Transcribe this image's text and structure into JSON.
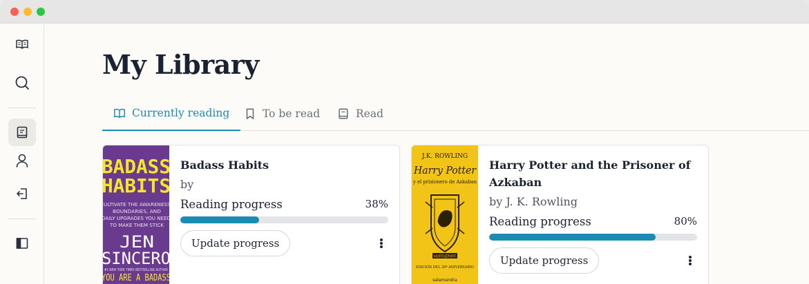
{
  "window": {
    "controls": [
      "close",
      "minimize",
      "maximize"
    ]
  },
  "sidebar": {
    "items": [
      {
        "icon": "open-book-icon",
        "active": false
      },
      {
        "icon": "search-icon",
        "active": false
      },
      {
        "icon": "library-book-icon",
        "active": true
      },
      {
        "icon": "user-icon",
        "active": false
      },
      {
        "icon": "logout-icon",
        "active": false
      },
      {
        "icon": "sidebar-toggle-icon",
        "active": false
      }
    ]
  },
  "page": {
    "title": "My Library"
  },
  "tabs": [
    {
      "label": "Currently reading",
      "icon": "open-book-icon",
      "active": true
    },
    {
      "label": "To be read",
      "icon": "bookmark-icon",
      "active": false
    },
    {
      "label": "Read",
      "icon": "closed-book-icon",
      "active": false
    }
  ],
  "books": [
    {
      "title": "Badass Habits",
      "author": "by",
      "progress_label": "Reading progress",
      "progress_text": "38%",
      "progress": 0.38,
      "update_label": "Update progress",
      "cover": {
        "lines": [
          "BADASS",
          "HABITS",
          "CULTIVATE THE AWARENESS,",
          "BOUNDARIES, AND",
          "DAILY UPGRADES YOU NEED",
          "TO MAKE THEM STICK",
          "JEN",
          "SINCERO",
          "#1 NEW YORK TIMES BESTSELLING AUTHOR",
          "YOU ARE A BADASS"
        ],
        "color": "#6a3a8e"
      }
    },
    {
      "title": "Harry Potter and the Prisoner of Azkaban",
      "author": "by J. K. Rowling",
      "progress_label": "Reading progress",
      "progress_text": "80%",
      "progress": 0.8,
      "update_label": "Update progress",
      "cover": {
        "lines": [
          "J.K. ROWLING",
          "Harry Potter",
          "y el prisionero de Azkaban",
          "HUFFLEPUFF",
          "EDICIÓN DEL 20º ANIVERSARIO",
          "salamandra"
        ],
        "color": "#f2c417"
      }
    }
  ],
  "colors": {
    "accent": "#1a8bb2",
    "progress_track": "#e3e4e8"
  }
}
